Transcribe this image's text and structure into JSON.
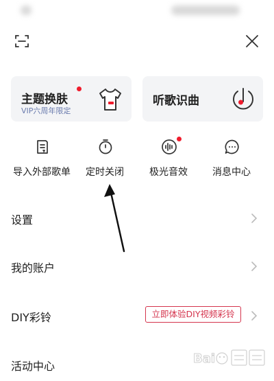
{
  "top": {
    "scan_icon": "scan-icon",
    "close_icon": "close-icon"
  },
  "cards": [
    {
      "title": "主题换肤",
      "subtitle": "VIP六周年限定",
      "has_dot": true,
      "icon": "tshirt-icon"
    },
    {
      "title": "听歌识曲",
      "icon": "music-recognize-icon"
    }
  ],
  "actions": [
    {
      "label": "导入外部歌单",
      "icon": "import-playlist-icon"
    },
    {
      "label": "定时关闭",
      "icon": "timer-icon"
    },
    {
      "label": "极光音效",
      "icon": "soundwave-icon",
      "has_dot": true
    },
    {
      "label": "消息中心",
      "icon": "message-icon"
    }
  ],
  "menu": [
    {
      "label": "设置"
    },
    {
      "label": "我的账户"
    },
    {
      "label": "DIY彩铃",
      "tag": "立即体验DIY视频彩铃"
    },
    {
      "label": "活动中心"
    }
  ],
  "watermark": {
    "brand": "Baidu 经验"
  },
  "colors": {
    "accent_red": "#f01c2d",
    "card_bg": "#f3f4f6",
    "subtitle_blue": "#6b7cae",
    "promo_red": "#d4334c"
  }
}
